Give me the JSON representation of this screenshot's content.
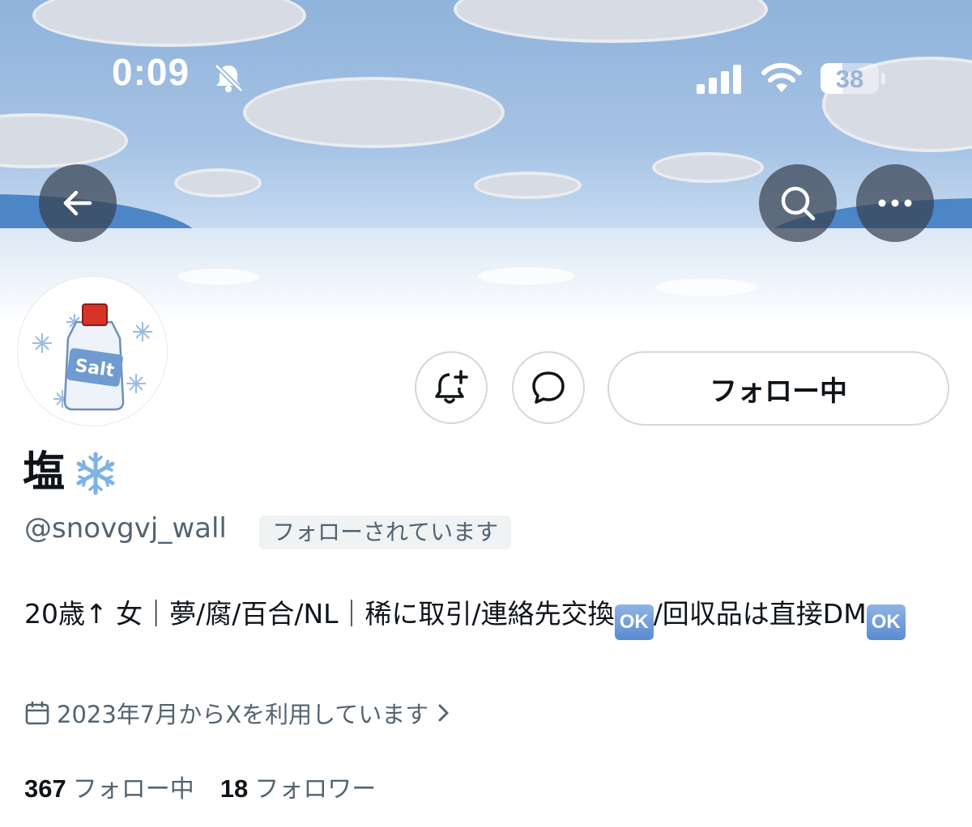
{
  "status_bar": {
    "time": "0:09",
    "battery": "38",
    "battery_level": 0.38
  },
  "profile": {
    "name": "塩",
    "name_emoji": "snowflake-emoji",
    "handle": "@snovgvj_wall",
    "follows_you": "フォローされています",
    "bio_parts": [
      "20歳↑ 女｜夢/腐/百合/NL｜稀に取引/連絡先交換",
      "/回収品は直接DM"
    ],
    "ok_badge": "OK",
    "joined": "2023年7月からXを利用しています",
    "following_count": "367",
    "following_label": "フォロー中",
    "followers_count": "18",
    "followers_label": "フォロワー",
    "avatar_text": "Salt"
  },
  "actions": {
    "follow_button": "フォロー中",
    "icons": [
      "back-arrow-icon",
      "search-icon",
      "more-icon",
      "bell-plus-icon",
      "message-icon",
      "calendar-icon",
      "chevron-right-icon"
    ]
  },
  "colors": {
    "text": "#0f1419",
    "secondary": "#536471",
    "border": "#cfd9de",
    "badge_bg": "#eff3f4"
  }
}
